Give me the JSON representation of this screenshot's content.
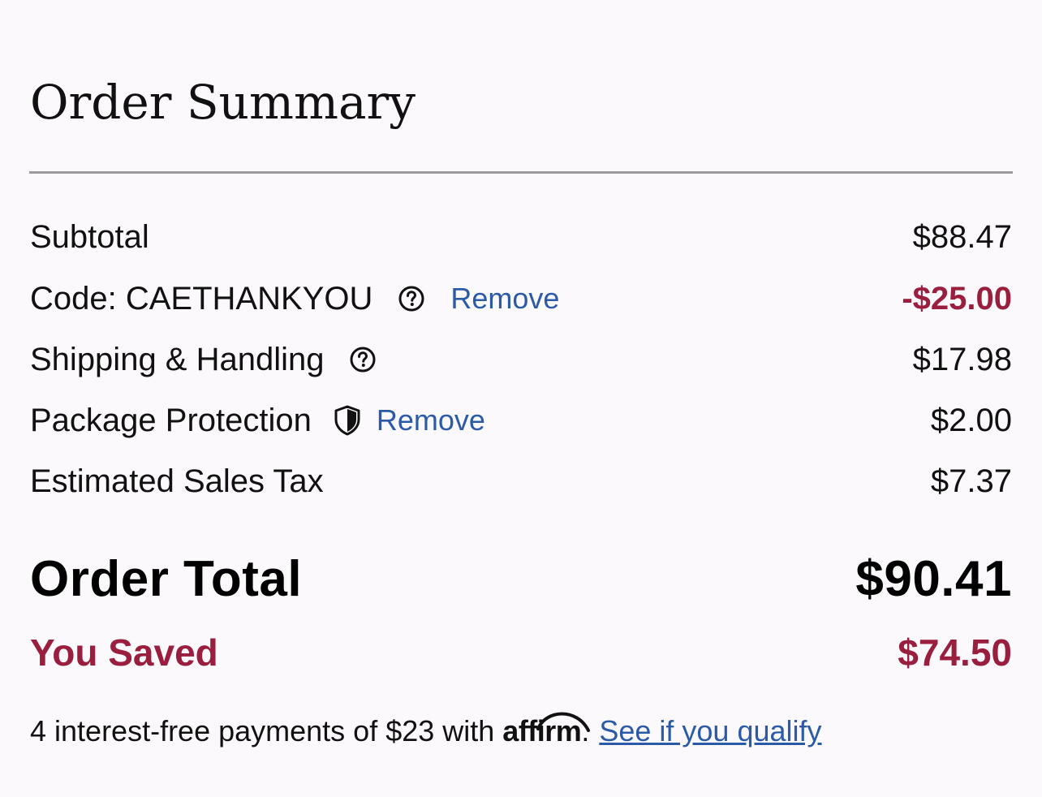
{
  "title": "Order Summary",
  "rows": {
    "subtotal": {
      "label": "Subtotal",
      "value": "$88.47"
    },
    "code": {
      "label": "Code: CAETHANKYOU",
      "remove": "Remove",
      "value": "-$25.00"
    },
    "shipping": {
      "label": "Shipping & Handling",
      "value": "$17.98"
    },
    "protection": {
      "label": "Package Protection",
      "remove": "Remove",
      "value": "$2.00"
    },
    "tax": {
      "label": "Estimated Sales Tax",
      "value": "$7.37"
    }
  },
  "total": {
    "label": "Order Total",
    "value": "$90.41"
  },
  "saved": {
    "label": "You Saved",
    "value": "$74.50"
  },
  "affirm": {
    "prefix": "4 interest-free payments of $23 with",
    "brand": "affirm",
    "dot": ".",
    "link": "See if you qualify"
  },
  "icons": {
    "help": "question-circle-icon",
    "shield": "shield-icon"
  },
  "colors": {
    "accent_red": "#9a1f3f",
    "link_blue": "#2b5ba8",
    "background": "#fcf9fc",
    "divider": "#9b9b9b"
  }
}
